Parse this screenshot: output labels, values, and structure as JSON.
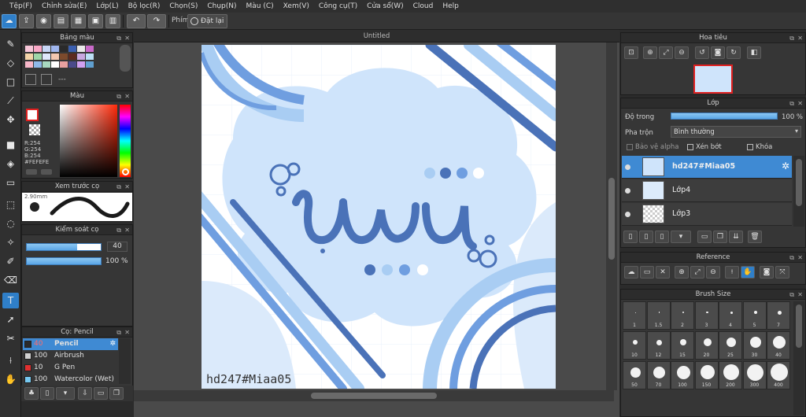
{
  "menu": [
    "Tệp(F)",
    "Chỉnh sửa(E)",
    "Lớp(L)",
    "Bộ lọc(R)",
    "Chọn(S)",
    "Chụp(N)",
    "Màu (C)",
    "Xem(V)",
    "Công cụ(T)",
    "Cửa sổ(W)",
    "Cloud",
    "Help"
  ],
  "toolbar": {
    "phim_label": "Phím",
    "reset_label": "Đặt lại"
  },
  "palette_panel": {
    "title": "Bảng màu",
    "dash": "---"
  },
  "color_panel": {
    "title": "Màu",
    "r": "R:254",
    "g": "G:254",
    "b": "B:254",
    "hex": "#FEFEFE",
    "current_color": "#fefefe"
  },
  "brush_preview_panel": {
    "title": "Xem trước cọ",
    "size": "2.90mm"
  },
  "brush_control_panel": {
    "title": "Kiểm soát cọ",
    "size_value": "40",
    "opacity_value": "100 %",
    "size_fraction": 0.68,
    "opacity_fraction": 1.0
  },
  "brush_list_panel": {
    "title": "Cọ: Pencil",
    "items": [
      {
        "size": "40",
        "name": "Pencil",
        "color": "#2a2a2a"
      },
      {
        "size": "100",
        "name": "Airbrush",
        "color": "#d0d0d0"
      },
      {
        "size": "10",
        "name": "G Pen",
        "color": "#e03030"
      },
      {
        "size": "100",
        "name": "Watercolor (Wet)",
        "color": "#76c8f0"
      }
    ]
  },
  "document": {
    "tab_title": "Untitled",
    "watermark": "hd247#Miaa05"
  },
  "navigator_panel": {
    "title": "Hoa tiêu"
  },
  "layer_panel": {
    "title": "Lớp",
    "opacity_label": "Độ trong",
    "opacity_value": "100 %",
    "blend_label": "Pha trộn",
    "blend_value": "Bình thường",
    "protect_alpha": "Bảo vệ alpha",
    "clipping": "Xén bớt",
    "lock": "Khóa",
    "layers": [
      {
        "name": "hd247#Miaa05",
        "selected": true
      },
      {
        "name": "Lớp4",
        "selected": false
      },
      {
        "name": "Lớp3",
        "selected": false
      }
    ]
  },
  "reference_panel": {
    "title": "Reference"
  },
  "brush_size_panel": {
    "title": "Brush Size",
    "sizes": [
      "1",
      "1.5",
      "2",
      "3",
      "4",
      "5",
      "7",
      "10",
      "12",
      "15",
      "20",
      "25",
      "30",
      "40",
      "50",
      "70",
      "100",
      "150",
      "200",
      "300",
      "400"
    ]
  },
  "colors": {
    "accent": "#3f8ad3",
    "art_blue_dark": "#4a72b8",
    "art_blue_mid": "#6f9ee0",
    "art_blue_light": "#a9cdf3",
    "art_bg": "#cfe4fb"
  }
}
